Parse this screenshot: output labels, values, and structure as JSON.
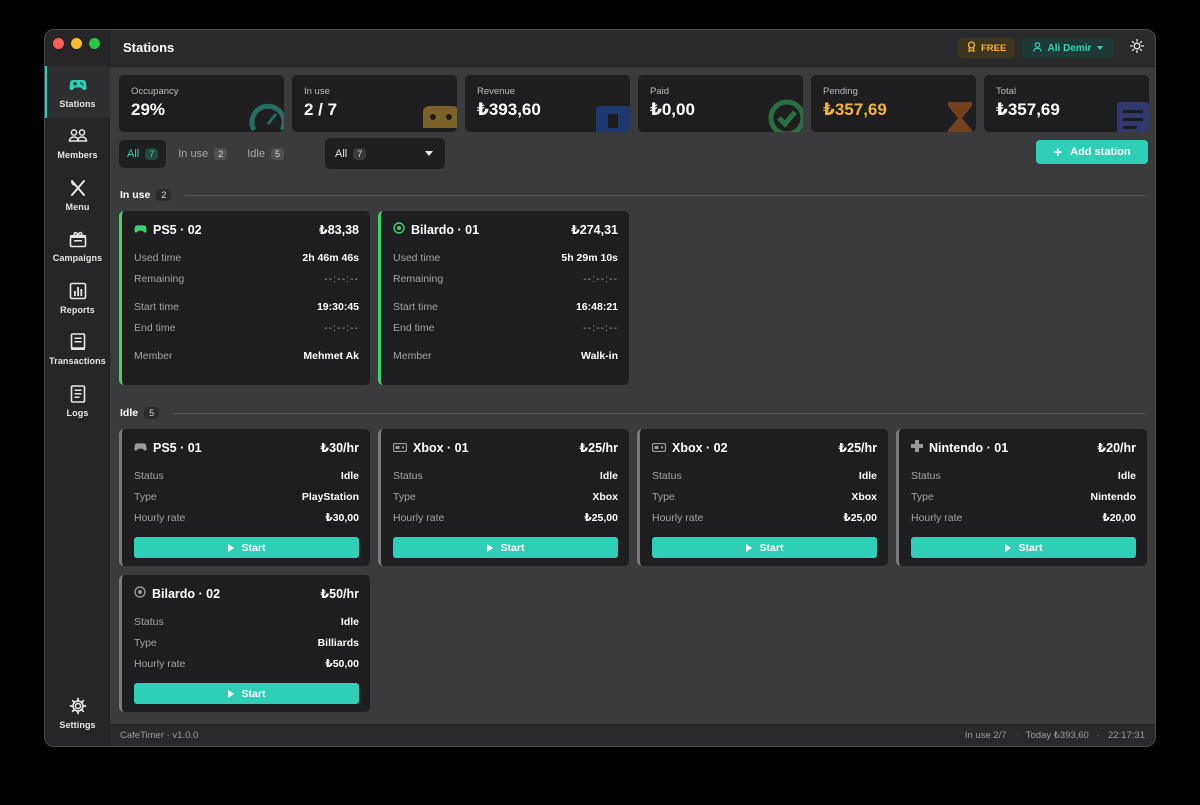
{
  "app": {
    "title": "Stations",
    "version": "CafeTimer · v1.0.0"
  },
  "colors": {
    "accent": "#2ecfb5",
    "active_border": "#3bd36b",
    "pending": "#f1b533",
    "free_badge": "#f1b533"
  },
  "header": {
    "plan": "FREE",
    "user": "Ali Demir"
  },
  "sidebar": {
    "items": [
      {
        "label": "Stations",
        "icon": "gamepad-icon"
      },
      {
        "label": "Members",
        "icon": "users-icon"
      },
      {
        "label": "Menu",
        "icon": "utensils-icon"
      },
      {
        "label": "Campaigns",
        "icon": "gift-icon"
      },
      {
        "label": "Reports",
        "icon": "chart-icon"
      },
      {
        "label": "Transactions",
        "icon": "receipt-icon"
      },
      {
        "label": "Logs",
        "icon": "document-icon"
      }
    ],
    "settings": "Settings"
  },
  "stats": [
    {
      "title": "Occupancy",
      "value": "29%"
    },
    {
      "title": "In use",
      "value": "2 / 7"
    },
    {
      "title": "Revenue",
      "value": "₺393,60"
    },
    {
      "title": "Paid",
      "value": "₺0,00"
    },
    {
      "title": "Pending",
      "value": "₺357,69"
    },
    {
      "title": "Total",
      "value": "₺357,69"
    }
  ],
  "filters": {
    "tabs": [
      {
        "label": "All",
        "count": "7"
      },
      {
        "label": "In use",
        "count": "2"
      },
      {
        "label": "Idle",
        "count": "5"
      }
    ],
    "select": {
      "value": "All",
      "count": "7"
    },
    "add_label": "Add station"
  },
  "sections": {
    "in_use": {
      "label": "In use",
      "count": "2"
    },
    "idle": {
      "label": "Idle",
      "count": "5"
    }
  },
  "labels": {
    "used_time": "Used time",
    "remaining": "Remaining",
    "start_time": "Start time",
    "end_time": "End time",
    "member": "Member",
    "status": "Status",
    "type": "Type",
    "hourly_rate": "Hourly rate",
    "start": "Start"
  },
  "in_use_stations": [
    {
      "name": "PS5 · 02",
      "amount": "₺83,38",
      "icon": "gamepad-icon",
      "used": "2h 46m 46s",
      "remaining": "--:--:--",
      "start": "19:30:45",
      "end": "--:--:--",
      "member": "Mehmet Ak"
    },
    {
      "name": "Bilardo · 01",
      "amount": "₺274,31",
      "icon": "billiard-ball-icon",
      "used": "5h 29m 10s",
      "remaining": "--:--:--",
      "start": "16:48:21",
      "end": "--:--:--",
      "member": "Walk-in"
    }
  ],
  "idle_stations": [
    {
      "name": "PS5 · 01",
      "rate_hr": "₺30/hr",
      "icon": "gamepad-icon",
      "status": "Idle",
      "type": "PlayStation",
      "rate": "₺30,00"
    },
    {
      "name": "Xbox · 01",
      "rate_hr": "₺25/hr",
      "icon": "console-icon",
      "status": "Idle",
      "type": "Xbox",
      "rate": "₺25,00"
    },
    {
      "name": "Xbox · 02",
      "rate_hr": "₺25/hr",
      "icon": "console-icon",
      "status": "Idle",
      "type": "Xbox",
      "rate": "₺25,00"
    },
    {
      "name": "Nintendo · 01",
      "rate_hr": "₺20/hr",
      "icon": "dpad-icon",
      "status": "Idle",
      "type": "Nintendo",
      "rate": "₺20,00"
    },
    {
      "name": "Bilardo · 02",
      "rate_hr": "₺50/hr",
      "icon": "billiard-ball-icon",
      "status": "Idle",
      "type": "Billiards",
      "rate": "₺50,00"
    }
  ],
  "footer": {
    "in_use": "In use 2/7",
    "today": "Today ₺393,60",
    "time": "22:17:31"
  }
}
